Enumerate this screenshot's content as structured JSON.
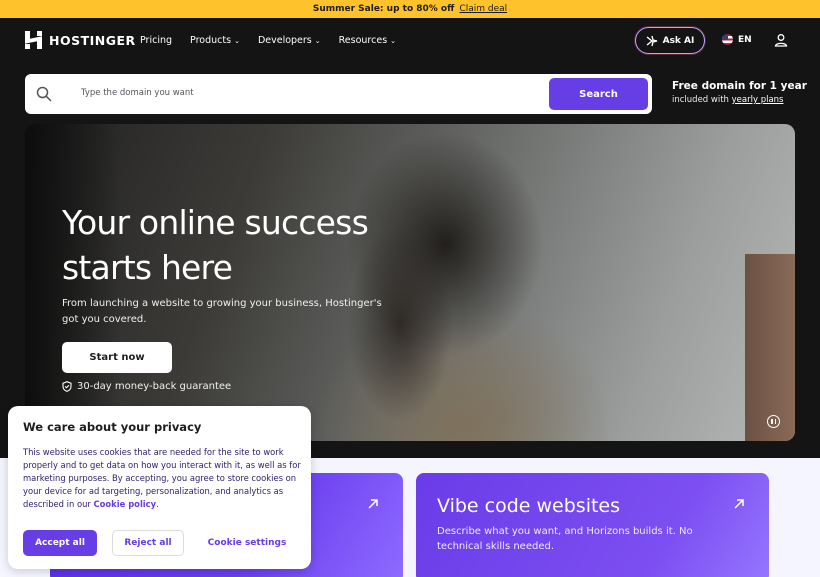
{
  "promo": {
    "text": "Summer Sale: up to 80% off",
    "link": "Claim deal"
  },
  "nav": {
    "logo": "HOSTINGER",
    "items": [
      "Pricing",
      "Products",
      "Developers",
      "Resources"
    ],
    "ask_ai": "Ask AI",
    "language": "EN"
  },
  "search": {
    "placeholder": "Type the domain you want",
    "button": "Search",
    "promo_title": "Free domain for 1 year",
    "promo_sub_prefix": "included with",
    "promo_sub_link": "yearly plans"
  },
  "hero": {
    "headline_line1": "Your online success",
    "headline_line2": "starts here",
    "subcopy": "From launching a website to growing your business, Hostinger's got you covered.",
    "cta": "Start now",
    "guarantee": "30-day money-back guarantee"
  },
  "cards": [
    {
      "title": "",
      "description": ""
    },
    {
      "title": "Vibe code websites",
      "description": "Describe what you want, and Horizons builds it. No technical skills needed."
    }
  ],
  "cookie": {
    "title": "We care about your privacy",
    "text": "This website uses cookies that are needed for the site to work properly and to get data on how you interact with it, as well as for marketing purposes. By accepting, you agree to store cookies on your device for ad targeting, personalization, and analytics as described in our",
    "policy_link": "Cookie policy",
    "accept": "Accept all",
    "reject": "Reject all",
    "settings": "Cookie settings"
  },
  "colors": {
    "accent": "#673de6",
    "promo_bg": "#fec22d",
    "dark_bg": "#141414"
  }
}
